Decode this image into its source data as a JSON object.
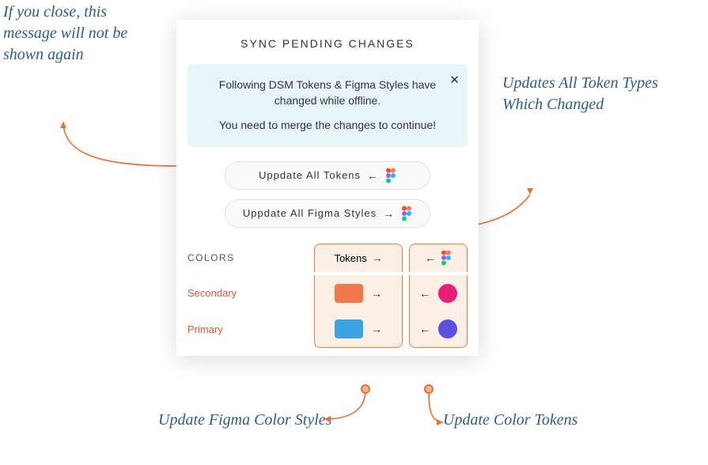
{
  "annotations": {
    "close": "If you close, this message will not be shown again",
    "updateAll": "Updates All Token Types Which Changed",
    "figmaStyles": "Update Figma Color Styles",
    "colorTokens": "Update Color Tokens"
  },
  "panel": {
    "title": "SYNC PENDING CHANGES",
    "notice": {
      "line1": "Following DSM Tokens & Figma Styles have changed while offline.",
      "line2": "You need to merge the changes to continue!",
      "closeGlyph": "✕"
    },
    "buttons": {
      "updateTokens": "Uppdate  All  Tokens",
      "updateFigma": "Uppdate  All  Figma  Styles"
    },
    "section": {
      "label": "COLORS",
      "tokensHeader": "Tokens"
    },
    "rows": [
      {
        "label": "Secondary",
        "swatch": "#f2784b",
        "circle": "#e81e78"
      },
      {
        "label": "Primary",
        "swatch": "#3ca3e0",
        "circle": "#5a51e2"
      }
    ]
  }
}
